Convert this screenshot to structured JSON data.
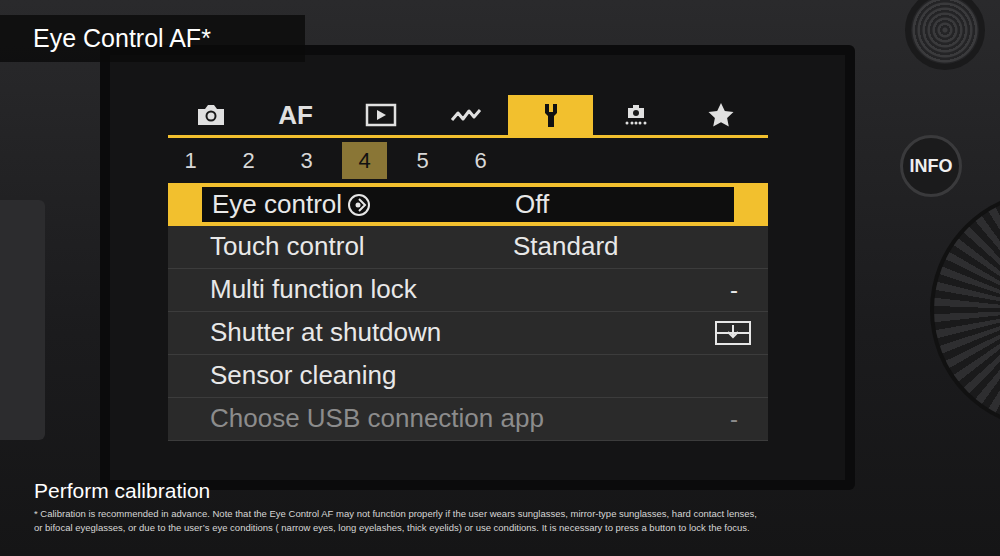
{
  "caption": {
    "title": "Eye Control AF*",
    "subtitle": "Perform calibration",
    "footnote": [
      "* Calibration is recommended in advance. Note that the Eye Control AF may not function properly if the user wears sunglasses, mirror-type sunglasses, hard contact lenses,",
      "or bifocal eyeglasses, or due to the user’s eye conditions ( narrow eyes, long eyelashes, thick eyelids) or use conditions. It is necessary to press a button to lock the focus."
    ]
  },
  "camera": {
    "info_button": "INFO"
  },
  "menu": {
    "tabs": [
      {
        "kind": "camera",
        "selected": false
      },
      {
        "kind": "text",
        "label": "AF",
        "selected": false
      },
      {
        "kind": "playback",
        "selected": false
      },
      {
        "kind": "wave",
        "selected": false
      },
      {
        "kind": "wrench",
        "selected": true
      },
      {
        "kind": "wireless",
        "selected": false
      },
      {
        "kind": "star",
        "selected": false
      }
    ],
    "pages": [
      {
        "label": "1",
        "selected": false
      },
      {
        "label": "2",
        "selected": false
      },
      {
        "label": "3",
        "selected": false
      },
      {
        "label": "4",
        "selected": true
      },
      {
        "label": "5",
        "selected": false
      },
      {
        "label": "6",
        "selected": false
      }
    ],
    "rows": [
      {
        "label": "Eye control",
        "label_icon": "eye",
        "value_kind": "text",
        "value": "Off",
        "selected": true,
        "disabled": false
      },
      {
        "label": "Touch control",
        "label_icon": "none",
        "value_kind": "text",
        "value": "Standard",
        "selected": false,
        "disabled": false
      },
      {
        "label": "Multi function lock",
        "label_icon": "none",
        "value_kind": "dash",
        "value": "-",
        "selected": false,
        "disabled": false
      },
      {
        "label": "Shutter at shutdown",
        "label_icon": "none",
        "value_kind": "icon",
        "selected": false,
        "disabled": false
      },
      {
        "label": "Sensor cleaning",
        "label_icon": "none",
        "value_kind": "none",
        "selected": false,
        "disabled": false
      },
      {
        "label": "Choose USB connection app",
        "label_icon": "none",
        "value_kind": "dash",
        "value": "-",
        "selected": false,
        "disabled": true
      }
    ]
  }
}
